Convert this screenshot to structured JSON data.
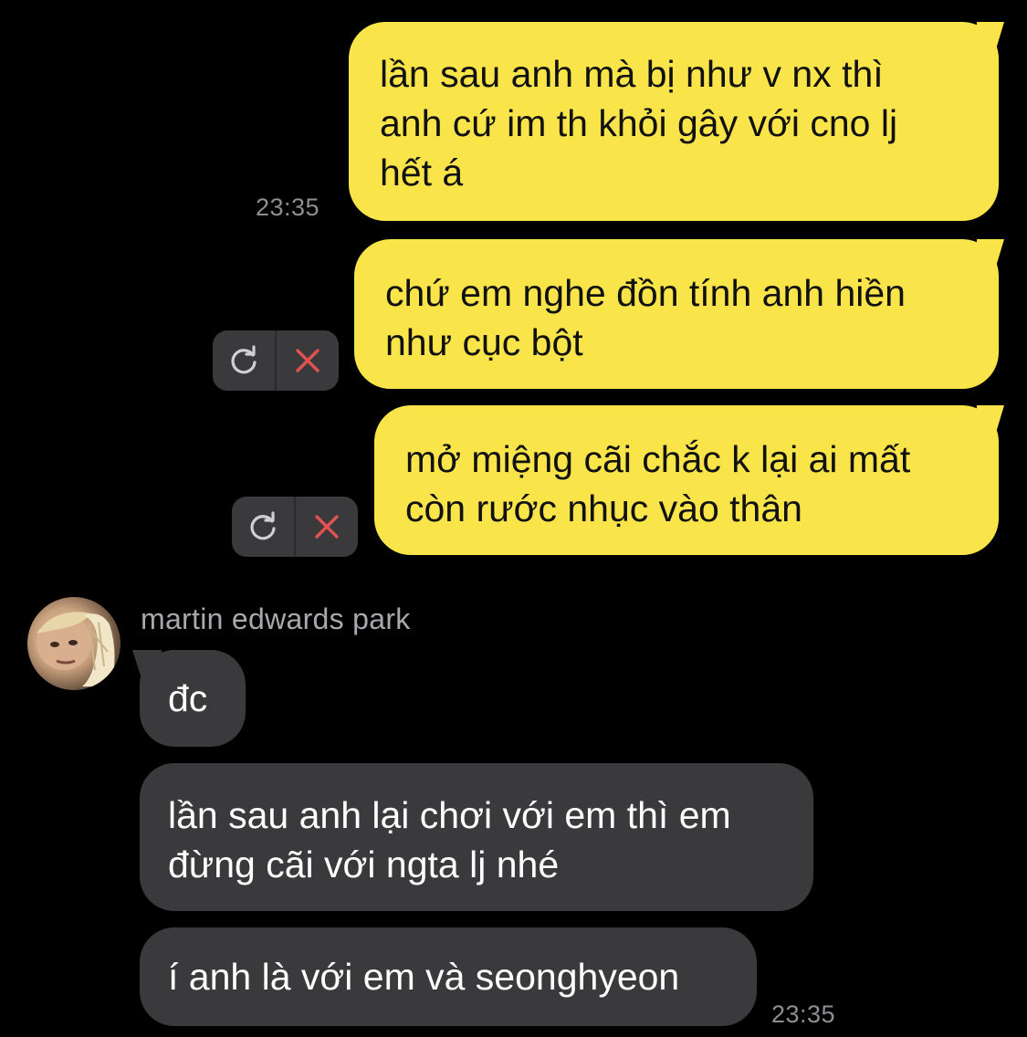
{
  "conversation": {
    "outgoing": [
      {
        "text": "lần sau anh mà bị như v nx thì\nanh  cứ im th khỏi gây với cno lj\nhết á",
        "time": "23:35"
      },
      {
        "text": "chứ em nghe đồn tính anh hiền\nnhư cục bột",
        "status": "failed"
      },
      {
        "text": "mở miệng cãi chắc k lại ai mất\ncòn rước nhục vào thân",
        "status": "failed"
      }
    ],
    "incoming": {
      "sender": "martin edwards park",
      "messages": [
        {
          "text": "đc"
        },
        {
          "text": "lần sau anh lại chơi với em thì em\nđừng cãi với ngta lj nhé"
        },
        {
          "text": "í anh là với em và seonghyeon",
          "time": "23:35"
        }
      ]
    }
  },
  "icons": {
    "retry": "retry-icon",
    "delete": "close-icon",
    "avatar": "avatar"
  },
  "colors": {
    "outgoing_bubble": "#f9e54a",
    "incoming_bubble": "#3a3a3c",
    "background": "#000000",
    "delete_icon": "#e0524f",
    "timestamp": "#8e8e93"
  }
}
